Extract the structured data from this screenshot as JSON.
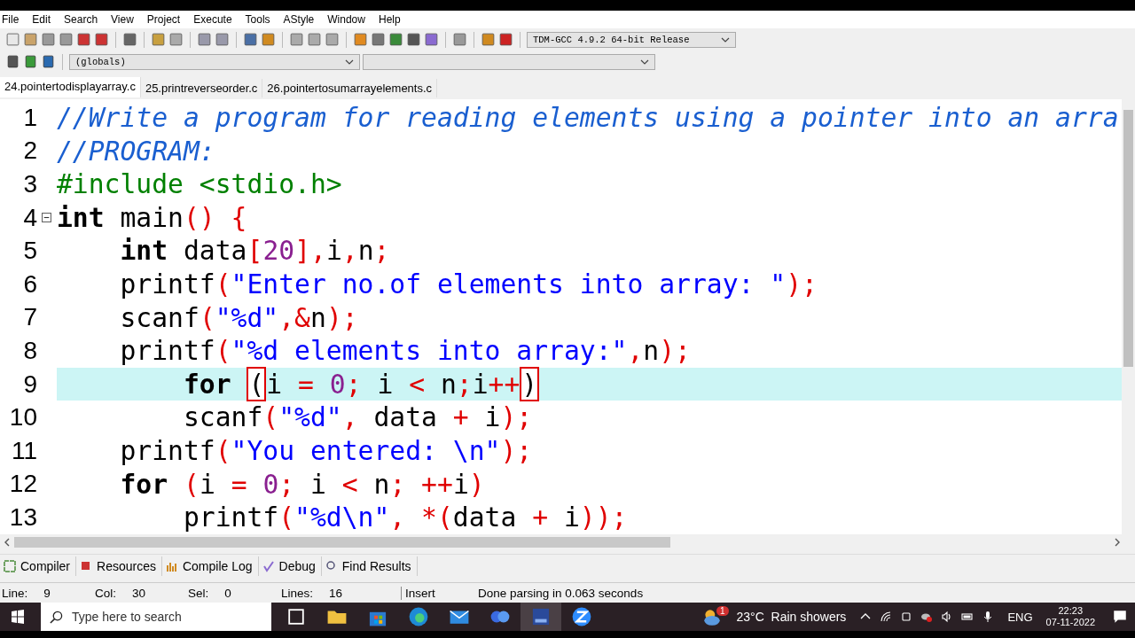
{
  "menu": [
    "File",
    "Edit",
    "Search",
    "View",
    "Project",
    "Execute",
    "Tools",
    "AStyle",
    "Window",
    "Help"
  ],
  "compiler_select": {
    "value": "TDM-GCC 4.9.2 64-bit Release"
  },
  "scope_select": {
    "value": "(globals)"
  },
  "tabs": [
    {
      "label": "24.pointertodisplayarray.c",
      "selected": true
    },
    {
      "label": "25.printreverseorder.c",
      "selected": false
    },
    {
      "label": "26.pointertosumarrayelements.c",
      "selected": false
    }
  ],
  "editor": {
    "lines": [
      {
        "number": "1",
        "current": false,
        "foldable": false,
        "tokens": [
          {
            "text": "//Write a program for reading elements using a pointer into an arra",
            "kind": "comment"
          }
        ]
      },
      {
        "number": "2",
        "current": false,
        "foldable": false,
        "tokens": [
          {
            "text": "//PROGRAM:",
            "kind": "comment"
          }
        ]
      },
      {
        "number": "3",
        "current": false,
        "foldable": false,
        "tokens": [
          {
            "text": "#include <stdio.h>",
            "kind": "preproc"
          }
        ]
      },
      {
        "number": "4",
        "current": false,
        "foldable": true,
        "tokens": [
          {
            "text": "int",
            "kind": "keyword"
          },
          {
            "text": " main",
            "kind": "plain"
          },
          {
            "text": "() {",
            "kind": "symbol"
          }
        ]
      },
      {
        "number": "5",
        "current": false,
        "foldable": false,
        "tokens": [
          {
            "text": "    int",
            "kind": "keyword"
          },
          {
            "text": " data",
            "kind": "plain"
          },
          {
            "text": "[",
            "kind": "symbol"
          },
          {
            "text": "20",
            "kind": "number"
          },
          {
            "text": "],",
            "kind": "symbol"
          },
          {
            "text": "i",
            "kind": "plain"
          },
          {
            "text": ",",
            "kind": "symbol"
          },
          {
            "text": "n",
            "kind": "plain"
          },
          {
            "text": ";",
            "kind": "symbol"
          }
        ]
      },
      {
        "number": "6",
        "current": false,
        "foldable": false,
        "tokens": [
          {
            "text": "    printf",
            "kind": "plain"
          },
          {
            "text": "(",
            "kind": "symbol"
          },
          {
            "text": "\"Enter no.of elements into array: \"",
            "kind": "string"
          },
          {
            "text": ");",
            "kind": "symbol"
          }
        ]
      },
      {
        "number": "7",
        "current": false,
        "foldable": false,
        "tokens": [
          {
            "text": "    scanf",
            "kind": "plain"
          },
          {
            "text": "(",
            "kind": "symbol"
          },
          {
            "text": "\"%d\"",
            "kind": "string"
          },
          {
            "text": ",&",
            "kind": "symbol"
          },
          {
            "text": "n",
            "kind": "plain"
          },
          {
            "text": ");",
            "kind": "symbol"
          }
        ]
      },
      {
        "number": "8",
        "current": false,
        "foldable": false,
        "tokens": [
          {
            "text": "    printf",
            "kind": "plain"
          },
          {
            "text": "(",
            "kind": "symbol"
          },
          {
            "text": "\"%d elements into array:\"",
            "kind": "string"
          },
          {
            "text": ",",
            "kind": "symbol"
          },
          {
            "text": "n",
            "kind": "plain"
          },
          {
            "text": ");",
            "kind": "symbol"
          }
        ]
      },
      {
        "number": "9",
        "current": true,
        "foldable": false,
        "tokens": [
          {
            "text": "        for ",
            "kind": "keyword"
          },
          {
            "text": "(",
            "kind": "match"
          },
          {
            "text": "i ",
            "kind": "plain"
          },
          {
            "text": "= ",
            "kind": "symbol"
          },
          {
            "text": "0",
            "kind": "number"
          },
          {
            "text": ";",
            "kind": "symbol"
          },
          {
            "text": " i ",
            "kind": "plain"
          },
          {
            "text": "<",
            "kind": "symbol"
          },
          {
            "text": " n",
            "kind": "plain"
          },
          {
            "text": ";",
            "kind": "symbol"
          },
          {
            "text": "i",
            "kind": "plain"
          },
          {
            "text": "++",
            "kind": "symbol"
          },
          {
            "text": ")",
            "kind": "match"
          }
        ]
      },
      {
        "number": "10",
        "current": false,
        "foldable": false,
        "tokens": [
          {
            "text": "        scanf",
            "kind": "plain"
          },
          {
            "text": "(",
            "kind": "symbol"
          },
          {
            "text": "\"%d\"",
            "kind": "string"
          },
          {
            "text": ",",
            "kind": "symbol"
          },
          {
            "text": " data ",
            "kind": "plain"
          },
          {
            "text": "+",
            "kind": "symbol"
          },
          {
            "text": " i",
            "kind": "plain"
          },
          {
            "text": ");",
            "kind": "symbol"
          }
        ]
      },
      {
        "number": "11",
        "current": false,
        "foldable": false,
        "tokens": [
          {
            "text": "    printf",
            "kind": "plain"
          },
          {
            "text": "(",
            "kind": "symbol"
          },
          {
            "text": "\"You entered: \\n\"",
            "kind": "string"
          },
          {
            "text": ");",
            "kind": "symbol"
          }
        ]
      },
      {
        "number": "12",
        "current": false,
        "foldable": false,
        "tokens": [
          {
            "text": "    for ",
            "kind": "keyword"
          },
          {
            "text": "(",
            "kind": "symbol"
          },
          {
            "text": "i ",
            "kind": "plain"
          },
          {
            "text": "= ",
            "kind": "symbol"
          },
          {
            "text": "0",
            "kind": "number"
          },
          {
            "text": ";",
            "kind": "symbol"
          },
          {
            "text": " i ",
            "kind": "plain"
          },
          {
            "text": "<",
            "kind": "symbol"
          },
          {
            "text": " n",
            "kind": "plain"
          },
          {
            "text": "; ++",
            "kind": "symbol"
          },
          {
            "text": "i",
            "kind": "plain"
          },
          {
            "text": ")",
            "kind": "symbol"
          }
        ]
      },
      {
        "number": "13",
        "current": false,
        "foldable": false,
        "tokens": [
          {
            "text": "        printf",
            "kind": "plain"
          },
          {
            "text": "(",
            "kind": "symbol"
          },
          {
            "text": "\"%d\\n\"",
            "kind": "string"
          },
          {
            "text": ", *(",
            "kind": "symbol"
          },
          {
            "text": "data ",
            "kind": "plain"
          },
          {
            "text": "+",
            "kind": "symbol"
          },
          {
            "text": " i",
            "kind": "plain"
          },
          {
            "text": "));",
            "kind": "symbol"
          }
        ]
      }
    ]
  },
  "bottom_tabs": [
    {
      "label": "Compiler",
      "kind": "grid"
    },
    {
      "label": "Resources",
      "kind": "stack"
    },
    {
      "label": "Compile Log",
      "kind": "bars"
    },
    {
      "label": "Debug",
      "kind": "check"
    },
    {
      "label": "Find Results",
      "kind": "find"
    }
  ],
  "status_bar": [
    {
      "label": "Line:",
      "value": "9"
    },
    {
      "label": "Col:",
      "value": "30"
    },
    {
      "label": "Sel:",
      "value": "0"
    },
    {
      "label": "Lines:",
      "value": "16"
    }
  ],
  "status_mode": "Insert",
  "status_message": "Done parsing in 0.063 seconds",
  "taskbar": {
    "search_placeholder": "Type here to search",
    "weather": "23°C  Rain showers",
    "weather_badge": "1",
    "language": "ENG",
    "time": "22:23",
    "date": "07-11-2022"
  }
}
